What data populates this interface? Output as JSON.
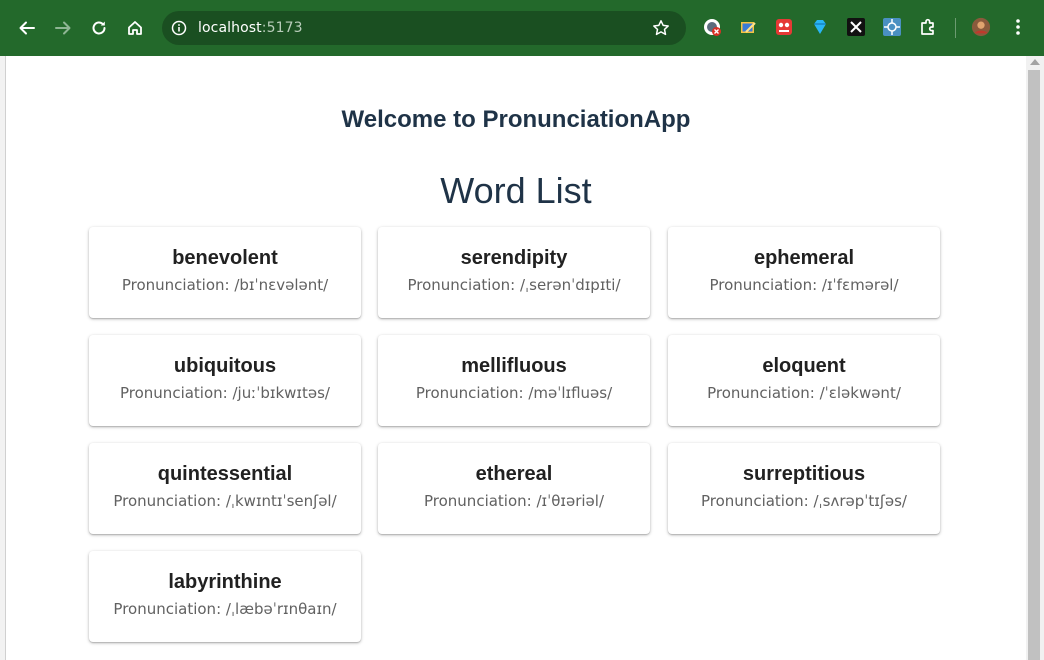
{
  "browser": {
    "url_host": "localhost",
    "url_port": ":5173",
    "icons": {
      "back": "arrow-left-icon",
      "forward": "arrow-right-icon",
      "reload": "reload-icon",
      "home": "home-icon",
      "site_info": "info-icon",
      "bookmark": "star-icon",
      "extensions": "puzzle-icon",
      "menu": "kebab-menu-icon"
    },
    "colors": {
      "toolbar": "#23692b",
      "omnibox": "#1a4f21"
    }
  },
  "page": {
    "heading": "Welcome to PronunciationApp",
    "list_title": "Word List",
    "pron_prefix": "Pronunciation: ",
    "words": [
      {
        "word": "benevolent",
        "pronunciation": "Pronunciation: /bɪˈnɛvələnt/"
      },
      {
        "word": "serendipity",
        "pronunciation": "Pronunciation: /ˌserənˈdɪpɪti/"
      },
      {
        "word": "ephemeral",
        "pronunciation": "Pronunciation: /ɪˈfɛmərəl/"
      },
      {
        "word": "ubiquitous",
        "pronunciation": "Pronunciation: /juːˈbɪkwɪtəs/"
      },
      {
        "word": "mellifluous",
        "pronunciation": "Pronunciation: /məˈlɪfluəs/"
      },
      {
        "word": "eloquent",
        "pronunciation": "Pronunciation: /ˈɛləkwənt/"
      },
      {
        "word": "quintessential",
        "pronunciation": "Pronunciation: /ˌkwɪntɪˈsenʃəl/"
      },
      {
        "word": "ethereal",
        "pronunciation": "Pronunciation: /ɪˈθɪəriəl/"
      },
      {
        "word": "surreptitious",
        "pronunciation": "Pronunciation: /ˌsʌrəpˈtɪʃəs/"
      },
      {
        "word": "labyrinthine",
        "pronunciation": "Pronunciation: /ˌlæbəˈrɪnθaɪn/"
      }
    ],
    "colors": {
      "heading": "#1f3347",
      "word": "#212121",
      "pronunciation": "#616161"
    }
  }
}
